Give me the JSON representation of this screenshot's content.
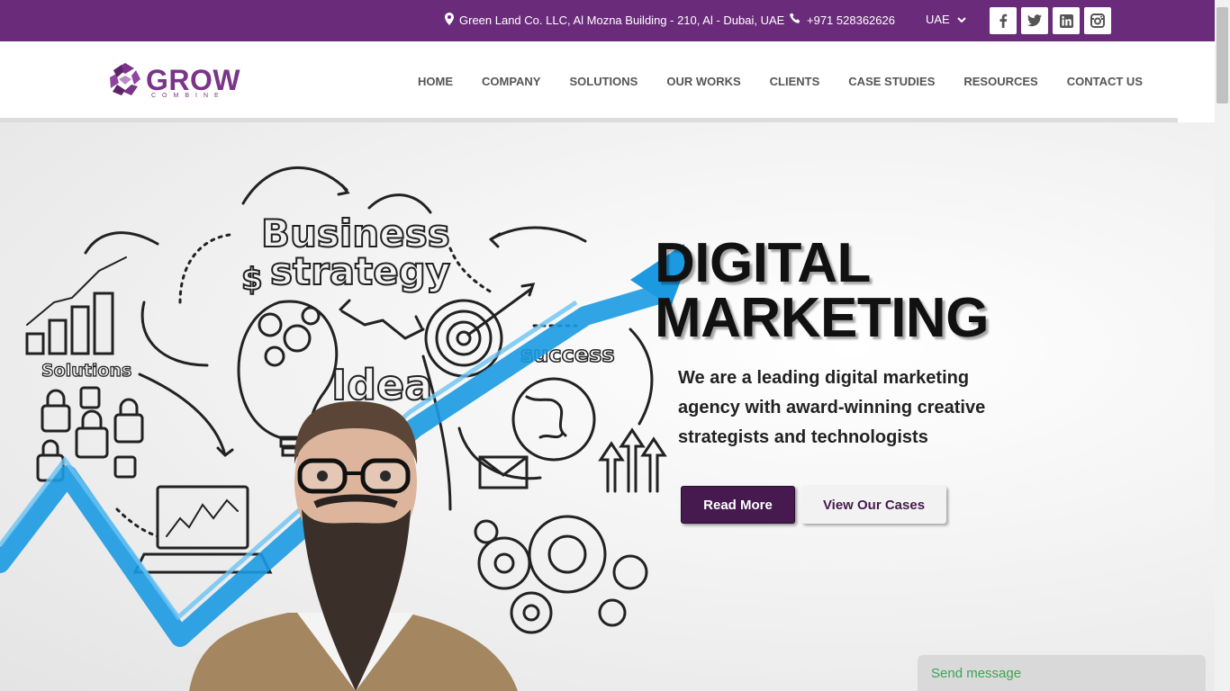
{
  "topbar": {
    "address": "Green Land Co. LLC, Al Mozna Building - 210, Al - Dubai, UAE",
    "phone": "+971 528362626",
    "region": "UAE",
    "socials": [
      {
        "icon": "facebook-icon"
      },
      {
        "icon": "twitter-icon"
      },
      {
        "icon": "linkedin-icon"
      },
      {
        "icon": "instagram-icon"
      }
    ]
  },
  "logo": {
    "word": "GROW",
    "sub": "COMBINE"
  },
  "nav": {
    "items": [
      "HOME",
      "COMPANY",
      "SOLUTIONS",
      "OUR WORKS",
      "CLIENTS",
      "CASE STUDIES",
      "RESOURCES",
      "CONTACT US"
    ]
  },
  "hero": {
    "title_line1": "DIGITAL",
    "title_line2": "MARKETING",
    "subtitle": "We are a leading digital marketing agency with award-winning creative strategists and technologists",
    "primary_button": "Read More",
    "secondary_button": "View Our Cases",
    "sketch_words": [
      "Business",
      "strategy",
      "Solutions",
      "Idea",
      "success",
      "$"
    ]
  },
  "chat": {
    "label": "Send message"
  },
  "colors": {
    "brand": "#6a2c7a",
    "button": "#461a4e",
    "accent_blue": "#1b9ae2",
    "chat_text": "#3aa650"
  }
}
